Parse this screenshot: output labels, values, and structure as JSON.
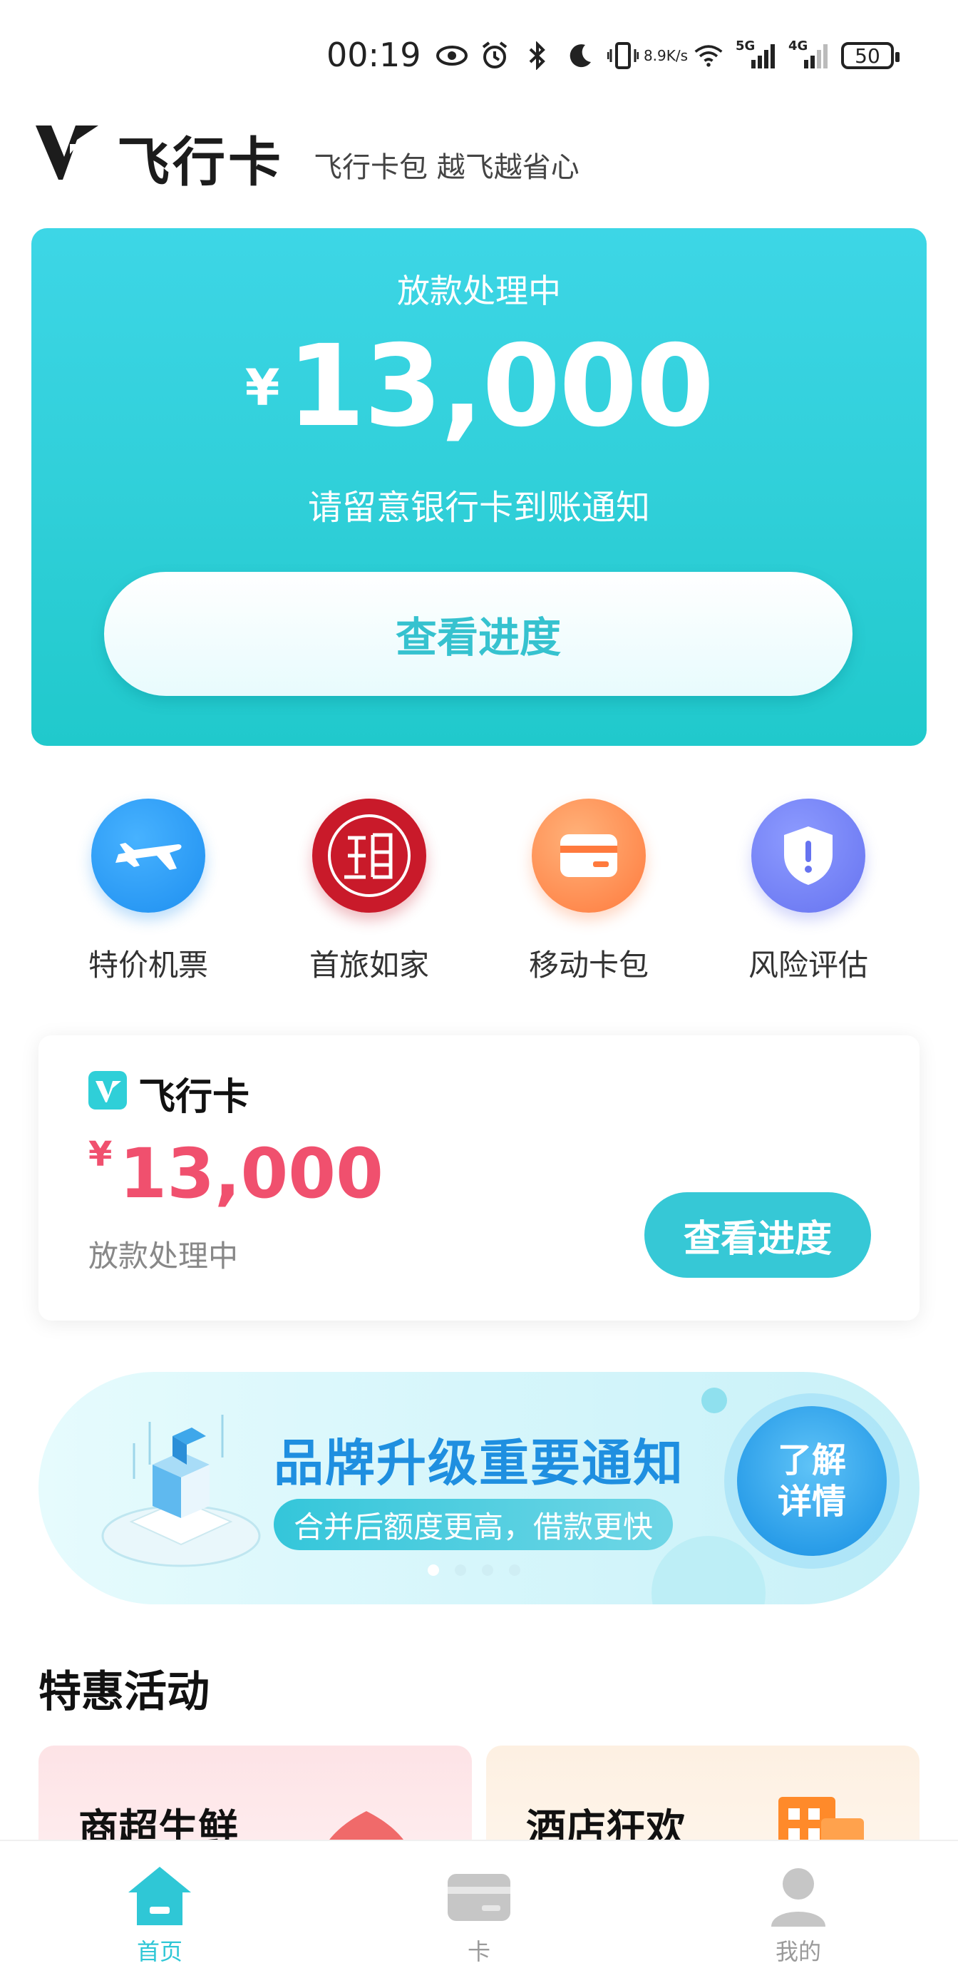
{
  "status_bar": {
    "time": "00:19",
    "net_speed_top": "8.9",
    "net_speed_bottom": "K/s",
    "sig1": "5G",
    "sig2": "4G",
    "battery": "50",
    "icons": [
      "eye-icon",
      "alarm-icon",
      "bluetooth-icon",
      "moon-icon",
      "vibrate-icon",
      "wifi-icon",
      "signal-icon",
      "signal-icon"
    ]
  },
  "header": {
    "brand_name": "飞行卡",
    "slogan": "飞行卡包  越飞越省心"
  },
  "hero": {
    "status": "放款处理中",
    "currency": "¥",
    "amount": "13,000",
    "note": "请留意银行卡到账通知",
    "button_label": "查看进度"
  },
  "quick_actions": [
    {
      "label": "特价机票",
      "icon": "airplane-icon",
      "color": "#1e8ff0"
    },
    {
      "label": "首旅如家",
      "icon": "seal-icon",
      "color": "#c91a2a"
    },
    {
      "label": "移动卡包",
      "icon": "card-icon",
      "color": "#ff7a3d"
    },
    {
      "label": "风险评估",
      "icon": "shield-icon",
      "color": "#6673f0"
    }
  ],
  "summary_card": {
    "name": "飞行卡",
    "currency": "¥",
    "amount": "13,000",
    "status": "放款处理中",
    "button_label": "查看进度"
  },
  "banner": {
    "title": "品牌升级重要通知",
    "subtitle": "合并后额度更高，借款更快",
    "cta_line1": "了解",
    "cta_line2": "详情",
    "active_dot": 0,
    "dot_count": 4
  },
  "promotions": {
    "title": "特惠活动",
    "items": [
      {
        "label": "商超生鲜",
        "icon": "peach-icon"
      },
      {
        "label": "酒店狂欢",
        "icon": "hotel-icon"
      }
    ]
  },
  "bottom_nav": {
    "items": [
      {
        "label": "首页",
        "icon": "home-icon",
        "active": true
      },
      {
        "label": "卡",
        "icon": "card-icon",
        "active": false
      },
      {
        "label": "我的",
        "icon": "user-icon",
        "active": false
      }
    ],
    "active_color": "#2fc7d6",
    "inactive_color": "#9a9a9a"
  },
  "colors": {
    "brand_teal": "#2fcfd8",
    "amount_pink": "#f0506e",
    "banner_blue": "#1f8fe0"
  }
}
